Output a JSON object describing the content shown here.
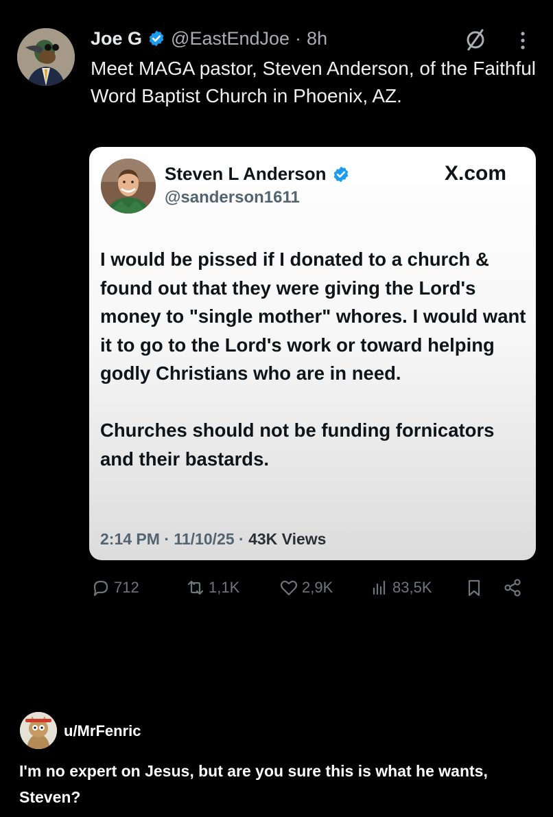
{
  "post": {
    "display_name": "Joe G",
    "handle": "@EastEndJoe",
    "separator": "·",
    "time": "8h",
    "text": "Meet MAGA pastor, Steven Anderson, of the Faithful Word Baptist Church in Phoenix, AZ."
  },
  "quoted": {
    "display_name": "Steven L Anderson",
    "handle": "@sanderson1611",
    "site": "X.com",
    "paragraphs": [
      "I would be pissed if I donated to a church & found out that they were giving the Lord's money to \"single mother\" whores. I would want it to go to the Lord's work or toward helping godly Christians who are in need.",
      "Churches should not be funding fornicators and their bastards."
    ],
    "timestamp": "2:14 PM · 11/10/25 · ",
    "views": "43K Views"
  },
  "actions": {
    "replies": "712",
    "reposts": "1,1K",
    "likes": "2,9K",
    "views": "83,5K"
  },
  "comment": {
    "username": "u/MrFenric",
    "text": "I'm no expert on Jesus, but are you sure this is what he wants, Steven?"
  },
  "colors": {
    "verified": "#1d9bf0",
    "background": "#000000",
    "muted": "#6e767d"
  },
  "icons": [
    "verified-icon",
    "slash-circle-icon",
    "more-icon",
    "reply-icon",
    "repost-icon",
    "like-icon",
    "views-icon",
    "bookmark-icon",
    "share-icon"
  ]
}
